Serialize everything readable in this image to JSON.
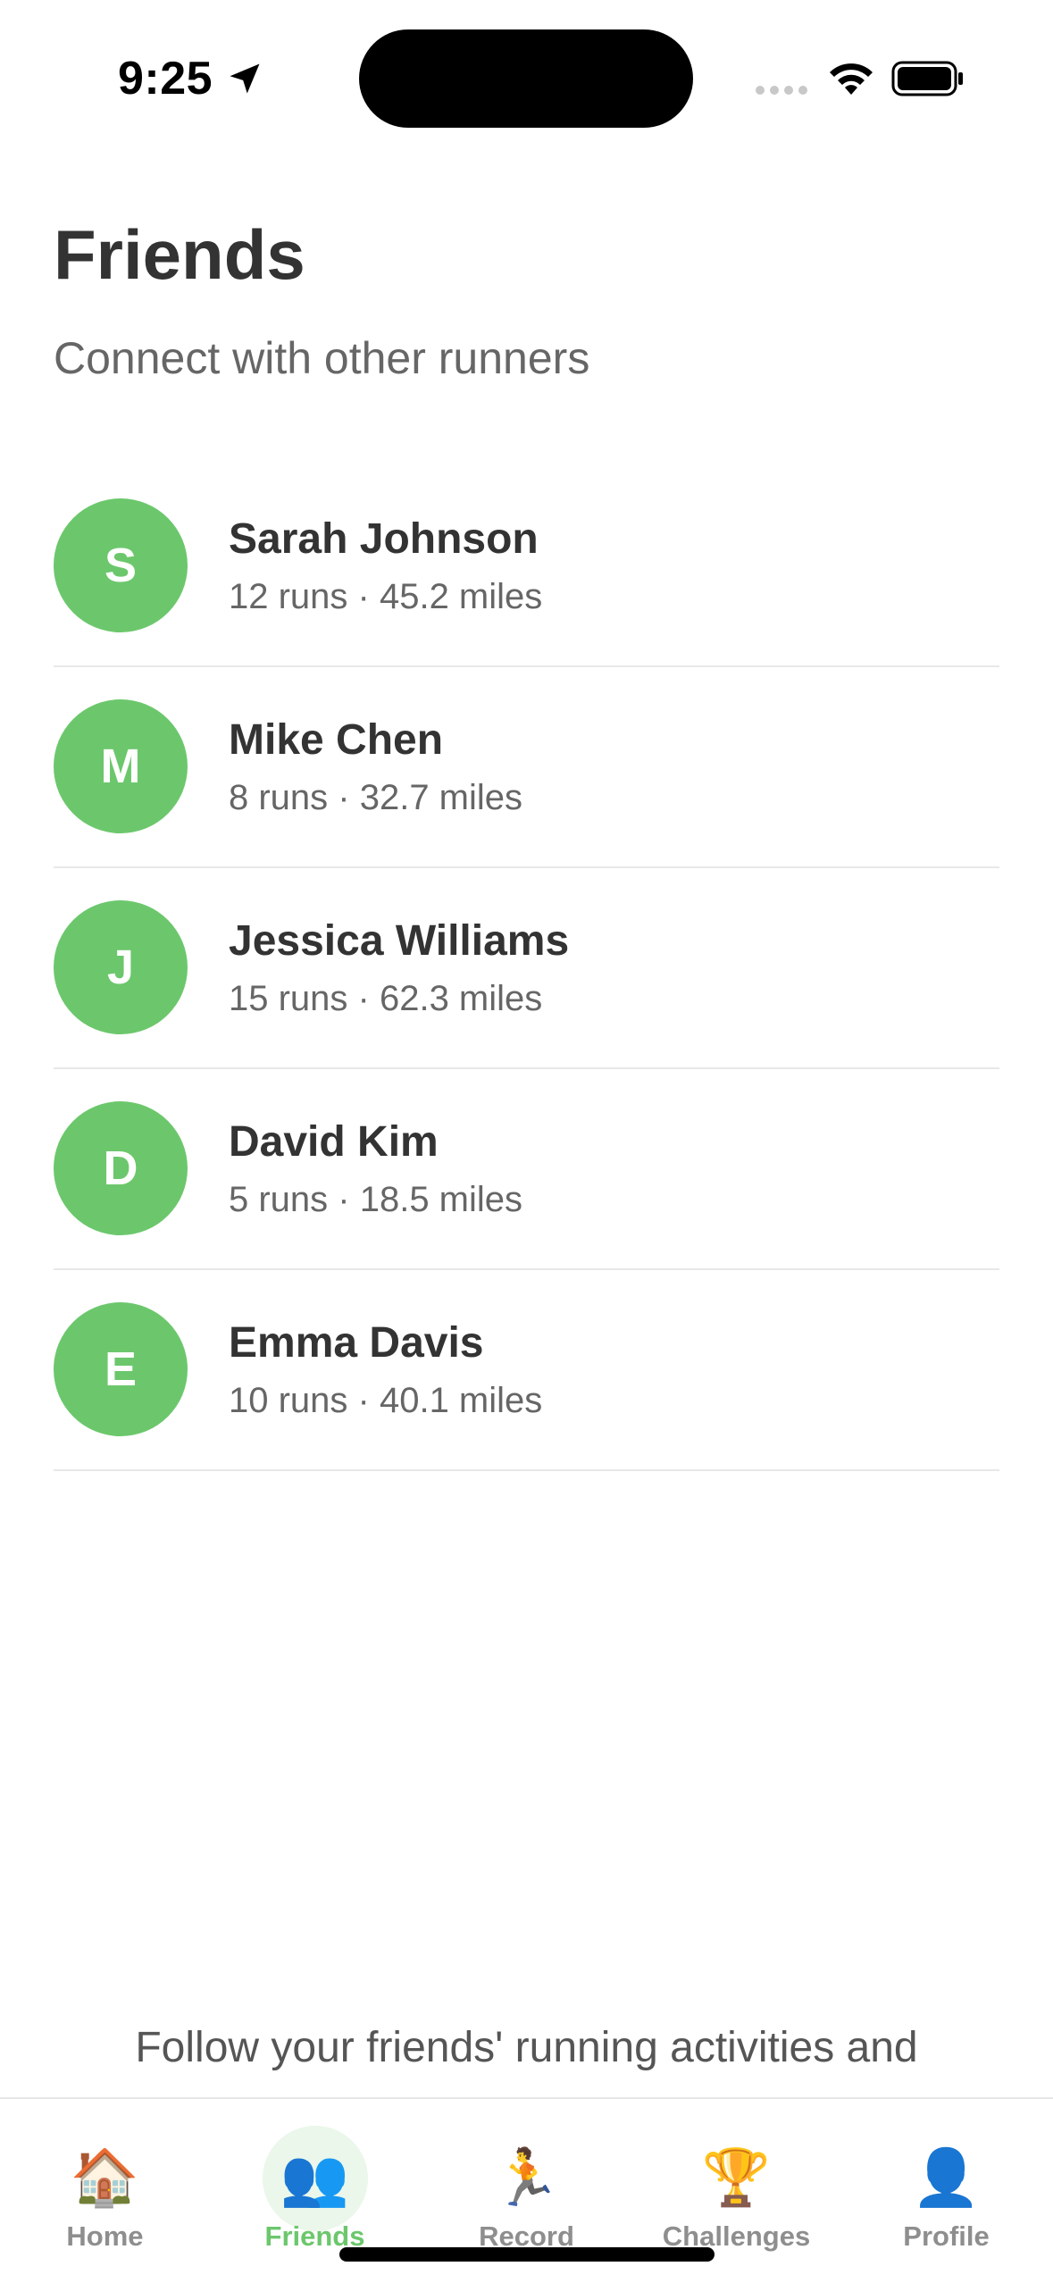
{
  "status_bar": {
    "time": "9:25",
    "icons": [
      "location-arrow-icon",
      "cellular-signal-icon",
      "wifi-icon",
      "battery-icon"
    ]
  },
  "header": {
    "title": "Friends",
    "subtitle": "Connect with other runners"
  },
  "friends": [
    {
      "initial": "S",
      "name": "Sarah Johnson",
      "stats": "12 runs · 45.2 miles"
    },
    {
      "initial": "M",
      "name": "Mike Chen",
      "stats": "8 runs · 32.7 miles"
    },
    {
      "initial": "J",
      "name": "Jessica Williams",
      "stats": "15 runs · 62.3 miles"
    },
    {
      "initial": "D",
      "name": "David Kim",
      "stats": "5 runs · 18.5 miles"
    },
    {
      "initial": "E",
      "name": "Emma Davis",
      "stats": "10 runs · 40.1 miles"
    }
  ],
  "footer": {
    "text": "Follow your friends' running activities and"
  },
  "tab_bar": {
    "active": "Friends",
    "tabs": [
      {
        "label": "Home",
        "icon": "🏠",
        "icon_name": "house-icon"
      },
      {
        "label": "Friends",
        "icon": "👥",
        "icon_name": "people-icon"
      },
      {
        "label": "Record",
        "icon": "🏃",
        "icon_name": "runner-icon"
      },
      {
        "label": "Challenges",
        "icon": "🏆",
        "icon_name": "trophy-icon"
      },
      {
        "label": "Profile",
        "icon": "👤",
        "icon_name": "person-icon"
      }
    ]
  },
  "colors": {
    "accent": "#6cc76c",
    "text_primary": "#333333",
    "text_secondary": "#666666",
    "tab_inactive": "#8e8e8e",
    "divider": "#e8e8e8"
  }
}
